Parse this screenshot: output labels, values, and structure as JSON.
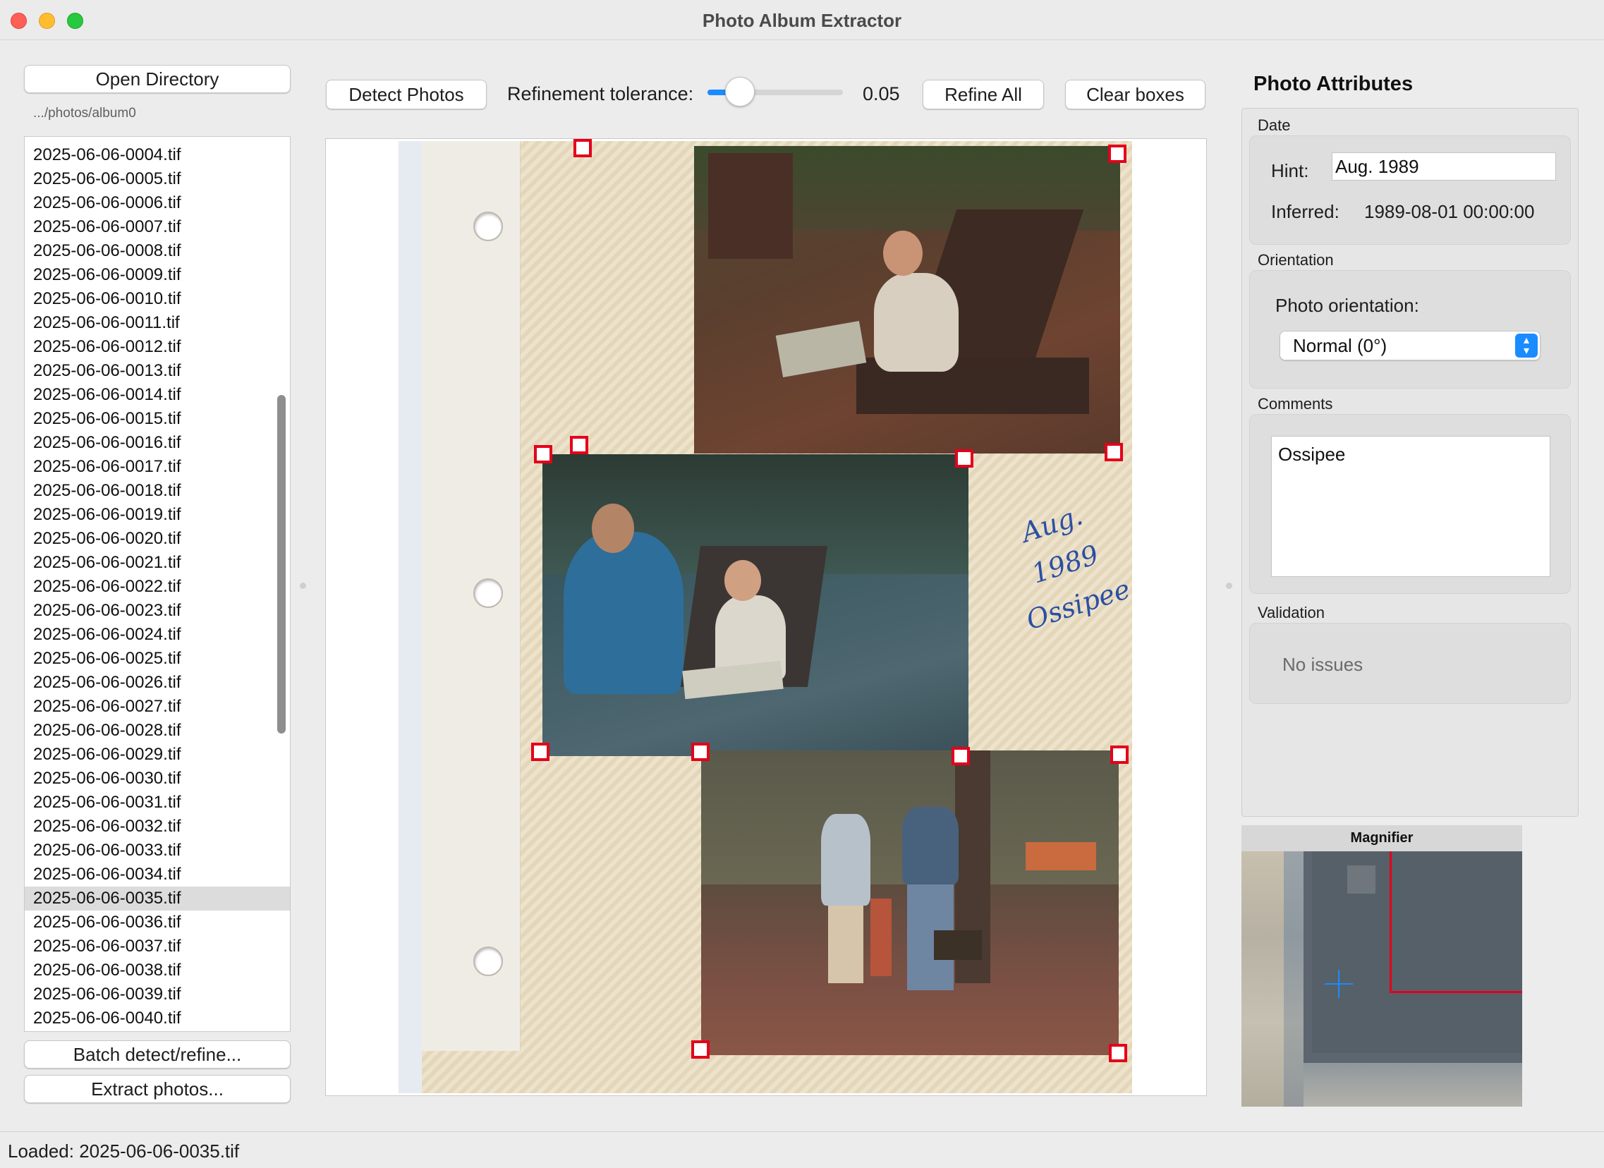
{
  "window": {
    "title": "Photo Album Extractor"
  },
  "left_panel": {
    "open_directory_label": "Open Directory",
    "directory_path": ".../photos/album0",
    "files": [
      "2025-06-06-0004.tif",
      "2025-06-06-0005.tif",
      "2025-06-06-0006.tif",
      "2025-06-06-0007.tif",
      "2025-06-06-0008.tif",
      "2025-06-06-0009.tif",
      "2025-06-06-0010.tif",
      "2025-06-06-0011.tif",
      "2025-06-06-0012.tif",
      "2025-06-06-0013.tif",
      "2025-06-06-0014.tif",
      "2025-06-06-0015.tif",
      "2025-06-06-0016.tif",
      "2025-06-06-0017.tif",
      "2025-06-06-0018.tif",
      "2025-06-06-0019.tif",
      "2025-06-06-0020.tif",
      "2025-06-06-0021.tif",
      "2025-06-06-0022.tif",
      "2025-06-06-0023.tif",
      "2025-06-06-0024.tif",
      "2025-06-06-0025.tif",
      "2025-06-06-0026.tif",
      "2025-06-06-0027.tif",
      "2025-06-06-0028.tif",
      "2025-06-06-0029.tif",
      "2025-06-06-0030.tif",
      "2025-06-06-0031.tif",
      "2025-06-06-0032.tif",
      "2025-06-06-0033.tif",
      "2025-06-06-0034.tif",
      "2025-06-06-0035.tif",
      "2025-06-06-0036.tif",
      "2025-06-06-0037.tif",
      "2025-06-06-0038.tif",
      "2025-06-06-0039.tif",
      "2025-06-06-0040.tif"
    ],
    "selected_file": "2025-06-06-0035.tif",
    "batch_label": "Batch detect/refine...",
    "extract_label": "Extract photos..."
  },
  "toolbar": {
    "detect_label": "Detect Photos",
    "tolerance_label": "Refinement tolerance:",
    "tolerance_value": "0.05",
    "tolerance_fraction": 0.2,
    "refine_all_label": "Refine All",
    "clear_label": "Clear boxes"
  },
  "canvas": {
    "handwritten_note": [
      "Aug. 1989",
      "Ossipee"
    ]
  },
  "attributes": {
    "title": "Photo Attributes",
    "date": {
      "group_label": "Date",
      "hint_label": "Hint:",
      "hint_value": "Aug. 1989",
      "inferred_label": "Inferred:",
      "inferred_value": "1989-08-01 00:00:00"
    },
    "orientation": {
      "group_label": "Orientation",
      "field_label": "Photo orientation:",
      "selected": "Normal (0°)"
    },
    "comments": {
      "group_label": "Comments",
      "value": "Ossipee"
    },
    "validation": {
      "group_label": "Validation",
      "message": "No issues"
    }
  },
  "magnifier": {
    "title": "Magnifier"
  },
  "status": {
    "text": "Loaded: 2025-06-06-0035.tif"
  },
  "colors": {
    "accent": "#1a8cff",
    "handle": "#e3001b",
    "selection": "#dcdcdc"
  },
  "icons": [
    "close-icon",
    "minimize-icon",
    "zoom-icon",
    "updown-chevron-icon",
    "crosshair-icon"
  ]
}
